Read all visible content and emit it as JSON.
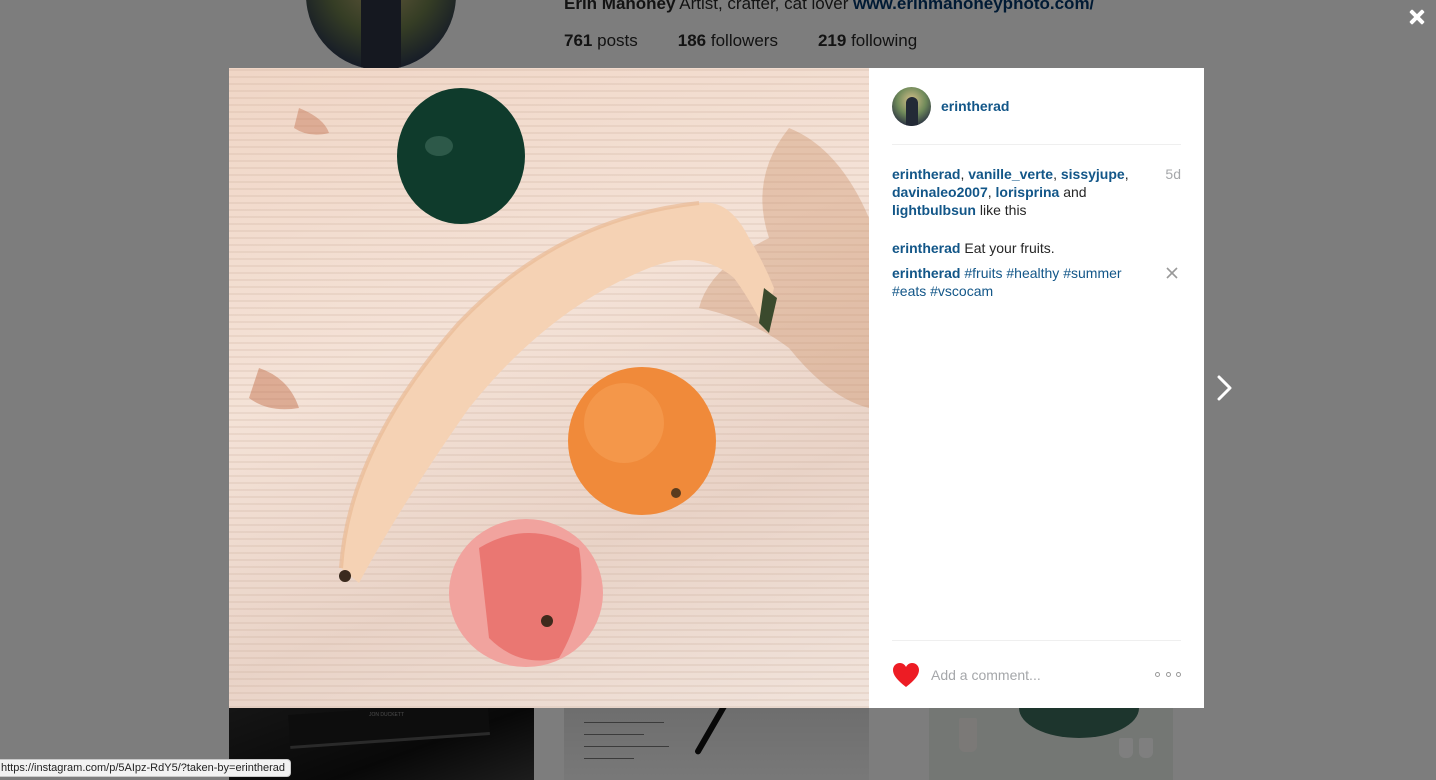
{
  "profile": {
    "full_name": "Erin Mahoney",
    "bio": "Artist, crafter, cat lover",
    "website": "www.erinmahoneyphoto.com/",
    "stats": [
      {
        "count": "761",
        "label": "posts"
      },
      {
        "count": "186",
        "label": "followers"
      },
      {
        "count": "219",
        "label": "following"
      }
    ]
  },
  "thumbs": {
    "book_label": "JON DUCKETT"
  },
  "post": {
    "username": "erintherad",
    "time_ago": "5d",
    "likers": [
      "erintherad",
      "vanille_verte",
      "sissyjupe",
      "davinaleo2007",
      "lorisprina",
      "lightbulbsun"
    ],
    "likes_and": "and",
    "likes_suffix": "like this",
    "comments": [
      {
        "user": "erintherad",
        "text": "Eat your fruits.",
        "tags": []
      },
      {
        "user": "erintherad",
        "text": "",
        "tags": [
          "#fruits",
          "#healthy",
          "#summer",
          "#eats",
          "#vscocam"
        ]
      }
    ],
    "comment_placeholder": "Add a comment..."
  },
  "icons": {
    "close": "close-icon",
    "next": "chevron-right-icon",
    "like": "heart-icon",
    "delete": "delete-x-icon",
    "more": "more-options-icon"
  },
  "colors": {
    "link": "#125688",
    "heart": "#ed1c24",
    "muted": "#a5a7aa"
  },
  "status_bar": {
    "url": "https://instagram.com/p/5AIpz-RdY5/?taken-by=erintherad"
  }
}
